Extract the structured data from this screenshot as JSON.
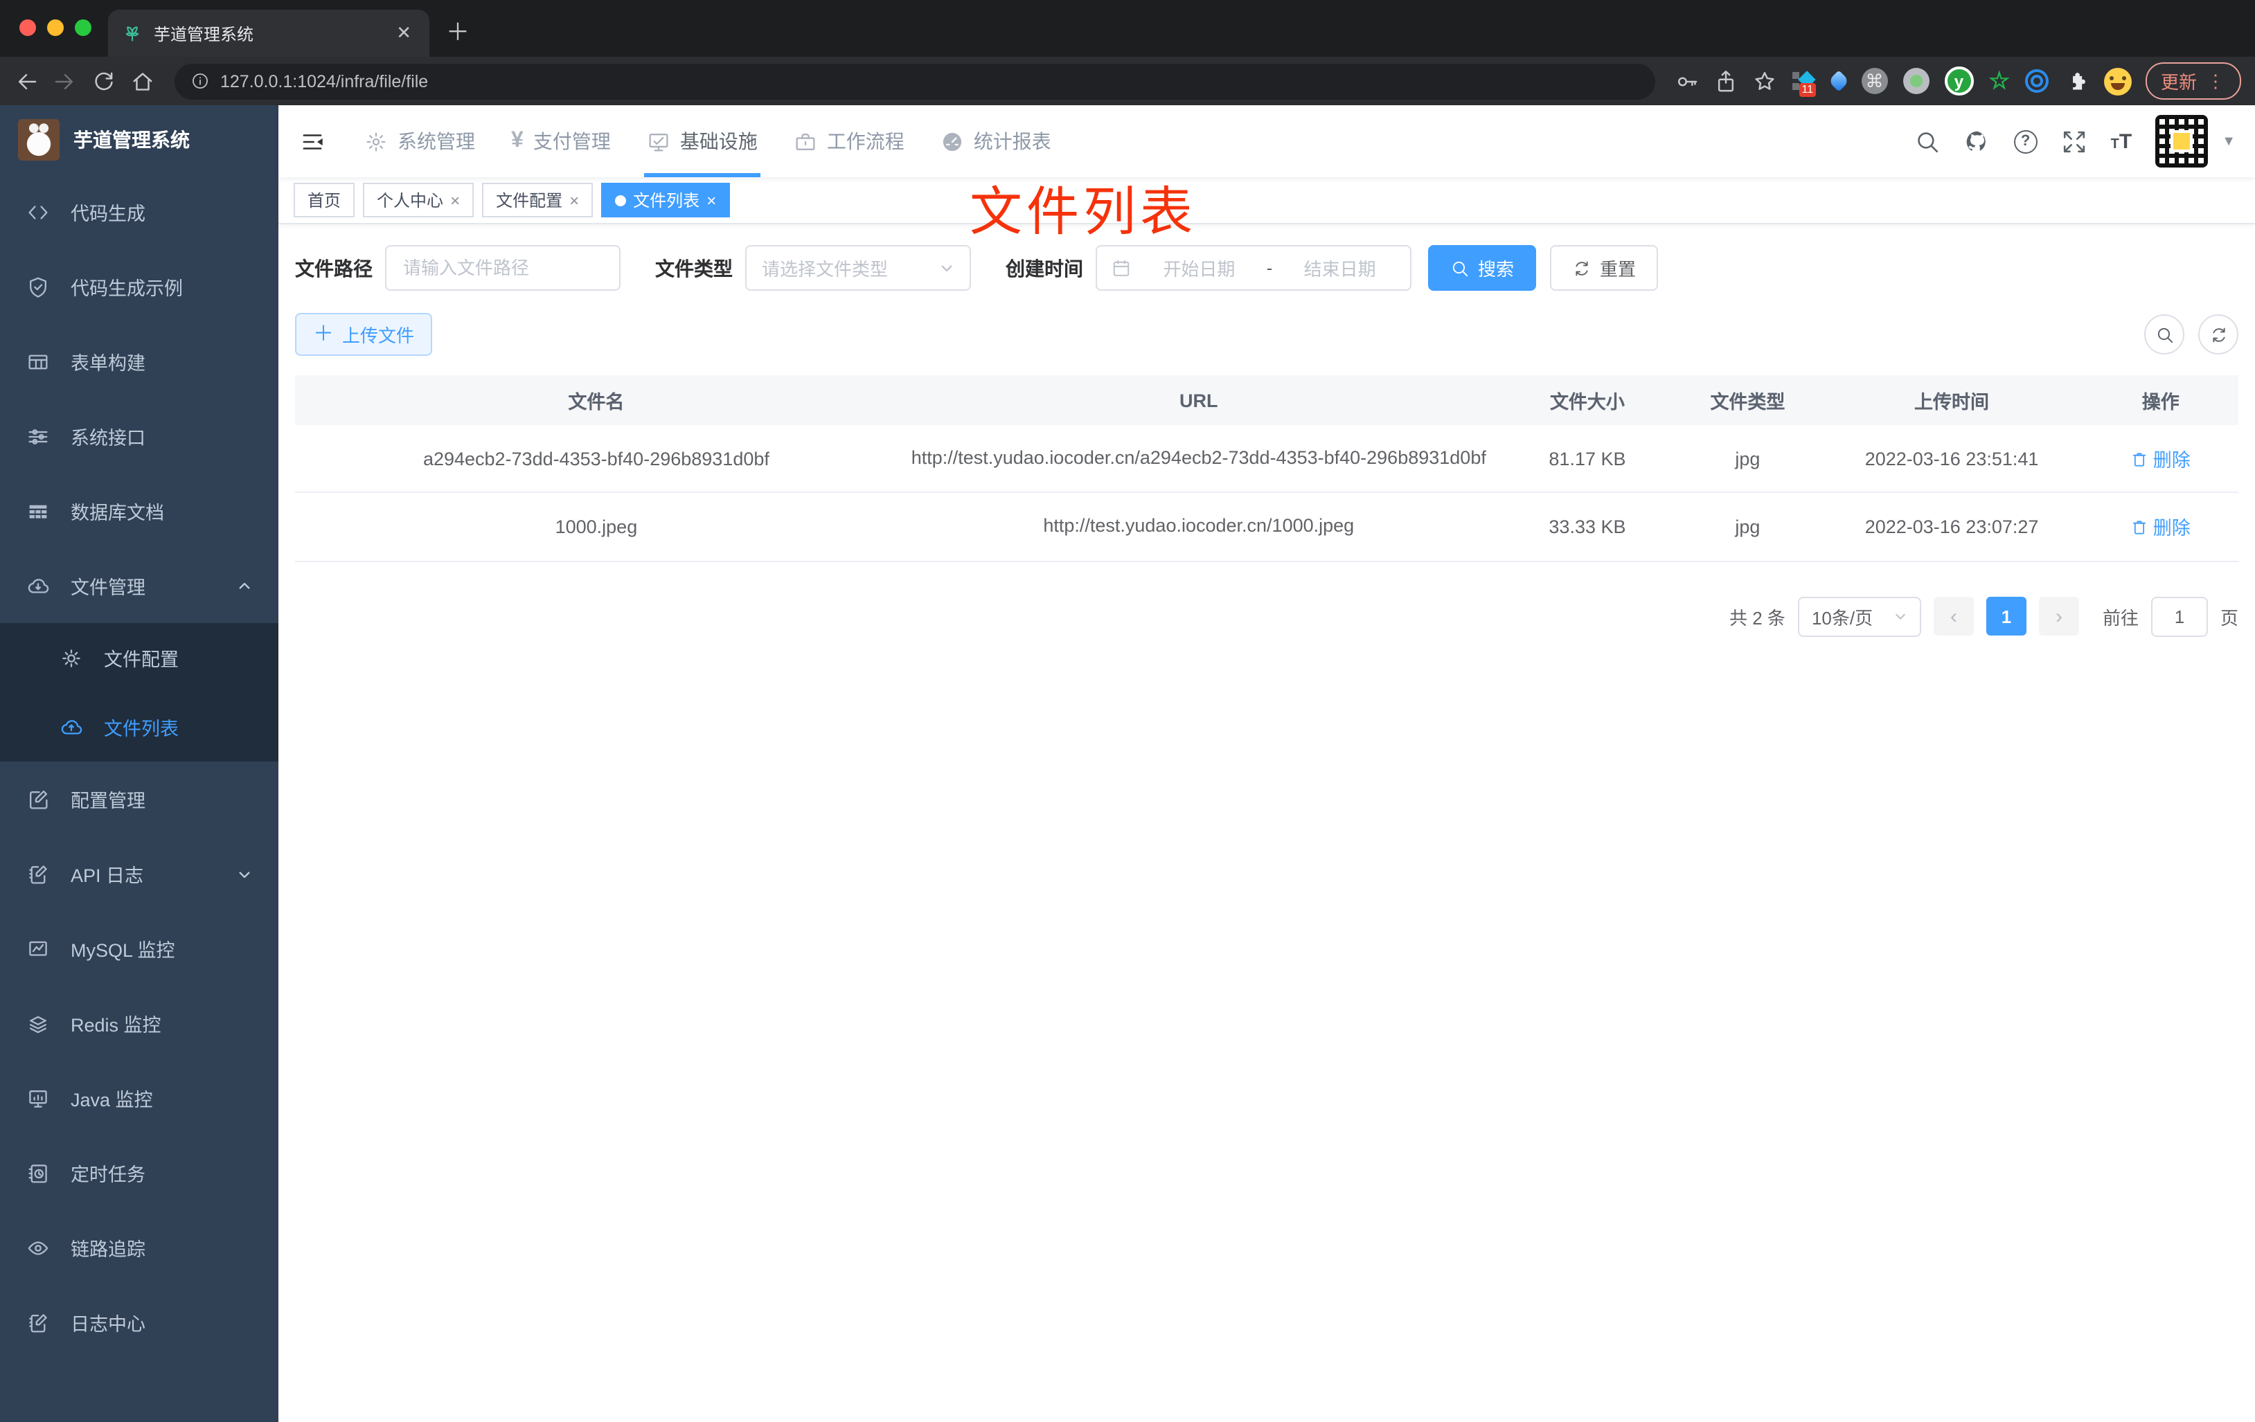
{
  "browser": {
    "tab_title": "芋道管理系统",
    "url": "127.0.0.1:1024/infra/file/file",
    "extension_badge": "11",
    "update_label": "更新"
  },
  "topnav": {
    "items": [
      {
        "label": "系统管理"
      },
      {
        "label": "支付管理"
      },
      {
        "label": "基础设施",
        "active": true
      },
      {
        "label": "工作流程"
      },
      {
        "label": "统计报表"
      }
    ]
  },
  "sidebar": {
    "title": "芋道管理系统",
    "items": [
      {
        "label": "代码生成"
      },
      {
        "label": "代码生成示例"
      },
      {
        "label": "表单构建"
      },
      {
        "label": "系统接口"
      },
      {
        "label": "数据库文档"
      },
      {
        "label": "文件管理",
        "expanded": true,
        "children": [
          {
            "label": "文件配置"
          },
          {
            "label": "文件列表",
            "active": true
          }
        ]
      },
      {
        "label": "配置管理"
      },
      {
        "label": "API 日志"
      },
      {
        "label": "MySQL 监控"
      },
      {
        "label": "Redis 监控"
      },
      {
        "label": "Java 监控"
      },
      {
        "label": "定时任务"
      },
      {
        "label": "链路追踪"
      },
      {
        "label": "日志中心"
      }
    ]
  },
  "tags": {
    "items": [
      {
        "label": "首页"
      },
      {
        "label": "个人中心",
        "closable": true
      },
      {
        "label": "文件配置",
        "closable": true
      },
      {
        "label": "文件列表",
        "closable": true,
        "active": true
      }
    ]
  },
  "annotation": {
    "text": "文件列表"
  },
  "filters": {
    "path_label": "文件路径",
    "path_placeholder": "请输入文件路径",
    "type_label": "文件类型",
    "type_placeholder": "请选择文件类型",
    "date_label": "创建时间",
    "date_start_placeholder": "开始日期",
    "date_separator": "-",
    "date_end_placeholder": "结束日期",
    "search_label": "搜索",
    "reset_label": "重置"
  },
  "toolbar": {
    "upload_label": "上传文件"
  },
  "table": {
    "headers": [
      "文件名",
      "URL",
      "文件大小",
      "文件类型",
      "上传时间",
      "操作"
    ],
    "rows": [
      {
        "name": "a294ecb2-73dd-4353-bf40-296b8931d0bf",
        "url": "http://test.yudao.iocoder.cn/a294ecb2-73dd-4353-bf40-296b8931d0bf",
        "size": "81.17 KB",
        "type": "jpg",
        "time": "2022-03-16 23:51:41",
        "action": "删除"
      },
      {
        "name": "1000.jpeg",
        "url": "http://test.yudao.iocoder.cn/1000.jpeg",
        "size": "33.33 KB",
        "type": "jpg",
        "time": "2022-03-16 23:07:27",
        "action": "删除"
      }
    ]
  },
  "pagination": {
    "total": "共 2 条",
    "page_size": "10条/页",
    "current_page": "1",
    "goto_prefix": "前往",
    "goto_value": "1",
    "goto_suffix": "页"
  },
  "colors": {
    "primary": "#409eff",
    "sidebar_bg": "#304156",
    "submenu_bg": "#1f2d3d",
    "annotation_red": "#f5320b"
  }
}
